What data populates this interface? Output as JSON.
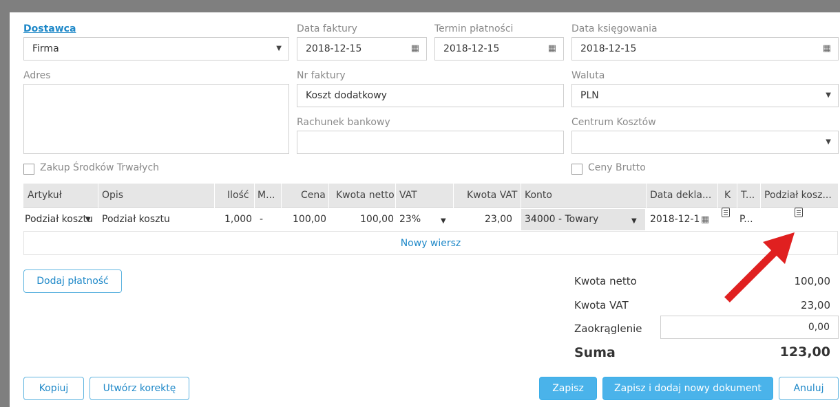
{
  "header": {
    "supplier_label": "Dostawca",
    "supplier_value": "Firma",
    "invoice_date_label": "Data faktury",
    "invoice_date_value": "2018-12-15",
    "payment_due_label": "Termin płatności",
    "payment_due_value": "2018-12-15",
    "posting_date_label": "Data księgowania",
    "posting_date_value": "2018-12-15",
    "address_label": "Adres",
    "address_value": "",
    "invoice_no_label": "Nr faktury",
    "invoice_no_value": "Koszt dodatkowy",
    "currency_label": "Waluta",
    "currency_value": "PLN",
    "bank_account_label": "Rachunek bankowy",
    "bank_account_value": "",
    "cost_center_label": "Centrum Kosztów",
    "cost_center_value": "",
    "fixed_assets_label": "Zakup Środków Trwałych",
    "gross_prices_label": "Ceny Brutto"
  },
  "grid": {
    "columns": [
      "Artykuł",
      "Opis",
      "Ilość",
      "M...",
      "Cena",
      "Kwota netto",
      "VAT",
      "Kwota VAT",
      "Konto",
      "Data dekla...",
      "K",
      "T...",
      "Podział kosz..."
    ],
    "row": {
      "article": "Podział kosztu",
      "description": "Podział kosztu",
      "quantity": "1,000",
      "unit": "-",
      "price": "100,00",
      "net_amount": "100,00",
      "vat": "23%",
      "vat_amount": "23,00",
      "account": "34000 - Towary",
      "decl_date": "2018-12-1",
      "t": "P..."
    },
    "new_row_label": "Nowy wiersz"
  },
  "add_payment_label": "Dodaj płatność",
  "summary": {
    "net_label": "Kwota netto",
    "net_value": "100,00",
    "vat_label": "Kwota VAT",
    "vat_value": "23,00",
    "rounding_label": "Zaokrąglenie",
    "rounding_value": "0,00",
    "total_label": "Suma",
    "total_value": "123,00"
  },
  "footer": {
    "copy_label": "Kopiuj",
    "correction_label": "Utwórz korektę",
    "save_label": "Zapisz",
    "save_new_label": "Zapisz i dodaj nowy dokument",
    "cancel_label": "Anuluj"
  },
  "colors": {
    "accent": "#1e88c8",
    "primary_button": "#4ab3ea",
    "annotation_arrow": "#e02020"
  },
  "icons": [
    "calendar-icon",
    "chevron-down-icon",
    "document-icon",
    "annotation-arrow"
  ]
}
